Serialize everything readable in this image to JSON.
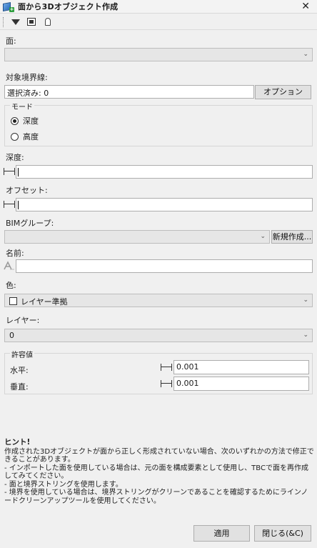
{
  "window": {
    "title": "面から3Dオブジェクト作成",
    "close_glyph": "✕"
  },
  "toolbar": {
    "icons": [
      "dropdown-triangle-icon",
      "image-icon",
      "lock-icon"
    ]
  },
  "face": {
    "label": "面:",
    "value": ""
  },
  "boundary": {
    "label": "対象境界線:",
    "value": "選択済み: 0",
    "options_label": "オプション"
  },
  "mode": {
    "legend": "モード",
    "options": [
      "深度",
      "高度"
    ],
    "selected": 0
  },
  "depth": {
    "label": "深度:",
    "value": ""
  },
  "offset": {
    "label": "オフセット:",
    "value": ""
  },
  "bim": {
    "label": "BIMグループ:",
    "value": "",
    "new_label": "新規作成..."
  },
  "name": {
    "label": "名前:",
    "value": ""
  },
  "color": {
    "label": "色:",
    "value": "レイヤー準拠"
  },
  "layer": {
    "label": "レイヤー:",
    "value": "0"
  },
  "tolerance": {
    "legend": "許容値",
    "horizontal_label": "水平:",
    "horizontal_value": "0.001",
    "vertical_label": "垂直:",
    "vertical_value": "0.001"
  },
  "hint": {
    "title": "ヒント!",
    "line1": "作成された3Dオブジェクトが面から正しく形成されていない場合、次のいずれかの方法で修正できることがあります。",
    "line2": " - インポートした面を使用している場合は、元の面を構成要素として使用し、TBCで面を再作成してみてください。",
    "line3": " - 面と境界ストリングを使用します。",
    "line4": " - 境界を使用している場合は、境界ストリングがクリーンであることを確認するためにラインノードクリーンアップツールを使用してください。"
  },
  "footer": {
    "apply_label": "適用",
    "close_label": "閉じる(&C)"
  }
}
